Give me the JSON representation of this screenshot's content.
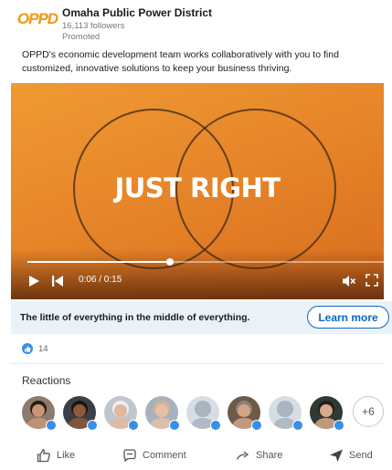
{
  "post": {
    "company_name": "Omaha Public Power District",
    "followers": "16,113 followers",
    "promoted": "Promoted",
    "logo_text": "OPPD",
    "text": "OPPD's economic development team works collaboratively with you to find customized, innovative solutions to keep your business thriving."
  },
  "video": {
    "headline": "JUST RIGHT",
    "time": "0:06 / 0:15",
    "progress": 0.4,
    "controls": {
      "play_icon": "play-icon",
      "skip_icon": "skip-back-icon",
      "mute_icon": "mute-icon",
      "fullscreen_icon": "fullscreen-icon"
    }
  },
  "cta": {
    "text": "The little of everything in the middle of everything.",
    "button_label": "Learn more",
    "accent": "#0a66c2"
  },
  "social": {
    "reaction_count": "14",
    "reactions_title": "Reactions",
    "more_label": "+6",
    "avatars": [
      {
        "name": "avatar-1",
        "skin": "#c99677",
        "hair": "#2b1a12",
        "bg": "#8c7a6e"
      },
      {
        "name": "avatar-2",
        "skin": "#8a5b3d",
        "hair": "#1d140f",
        "bg": "#3e3f46"
      },
      {
        "name": "avatar-3",
        "skin": "#e0b79f",
        "hair": "#f0f0ee",
        "bg": "#bfc6cf"
      },
      {
        "name": "avatar-4",
        "skin": "#e6c0a8",
        "hair": "#cfb493",
        "bg": "#a7b2be"
      },
      {
        "name": "avatar-5",
        "skin": "#a9b4bf",
        "hair": "#a9b4bf",
        "bg": "#d6dde3"
      },
      {
        "name": "avatar-6",
        "skin": "#d2a486",
        "hair": "#8c8078",
        "bg": "#6f5a4a"
      },
      {
        "name": "avatar-7",
        "skin": "#a9b4bf",
        "hair": "#a9b4bf",
        "bg": "#d6dde3"
      },
      {
        "name": "avatar-8",
        "skin": "#d7a98d",
        "hair": "#2a1c15",
        "bg": "#2f3a33"
      }
    ]
  },
  "actions": [
    {
      "label": "Like",
      "icon": "thumbs-up-icon"
    },
    {
      "label": "Comment",
      "icon": "comment-icon"
    },
    {
      "label": "Share",
      "icon": "share-icon"
    },
    {
      "label": "Send",
      "icon": "send-icon"
    }
  ]
}
